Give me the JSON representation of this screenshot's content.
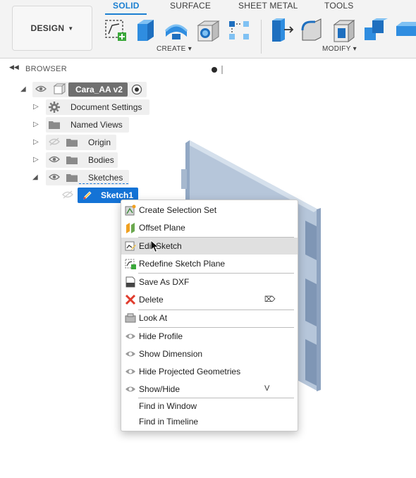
{
  "toolbar": {
    "design_label": "DESIGN",
    "tabs": [
      {
        "label": "SOLID",
        "active": true
      },
      {
        "label": "SURFACE",
        "active": false
      },
      {
        "label": "SHEET METAL",
        "active": false
      },
      {
        "label": "TOOLS",
        "active": false
      }
    ],
    "groups": {
      "create": "CREATE ▾",
      "modify": "MODIFY ▾"
    },
    "accent": "#1b7fd1"
  },
  "browser": {
    "title": "BROWSER",
    "root": "Cara_AA v2",
    "items": [
      {
        "label": "Document Settings"
      },
      {
        "label": "Named Views"
      },
      {
        "label": "Origin"
      },
      {
        "label": "Bodies"
      },
      {
        "label": "Sketches"
      }
    ],
    "sketch": "Sketch1",
    "selection_color": "#1473d6"
  },
  "context_menu": {
    "items": [
      {
        "label": "Create Selection Set",
        "icon": "selection-set-icon"
      },
      {
        "label": "Offset Plane",
        "icon": "offset-plane-icon"
      },
      {
        "label": "Edit Sketch",
        "icon": "edit-sketch-icon"
      },
      {
        "label": "Redefine Sketch Plane",
        "icon": "redefine-sketch-plane-icon"
      },
      {
        "label": "Save As DXF",
        "icon": "dxf-file-icon"
      },
      {
        "label": "Delete",
        "icon": "delete-x-icon",
        "shortcut": "⌦"
      },
      {
        "label": "Look At",
        "icon": "look-at-icon"
      },
      {
        "label": "Hide Profile",
        "icon": "eye-icon"
      },
      {
        "label": "Show Dimension",
        "icon": "eye-icon"
      },
      {
        "label": "Hide Projected Geometries",
        "icon": "eye-icon"
      },
      {
        "label": "Show/Hide",
        "icon": "eye-icon",
        "shortcut": "V"
      },
      {
        "label": "Find in Window"
      },
      {
        "label": "Find in Timeline"
      }
    ]
  }
}
